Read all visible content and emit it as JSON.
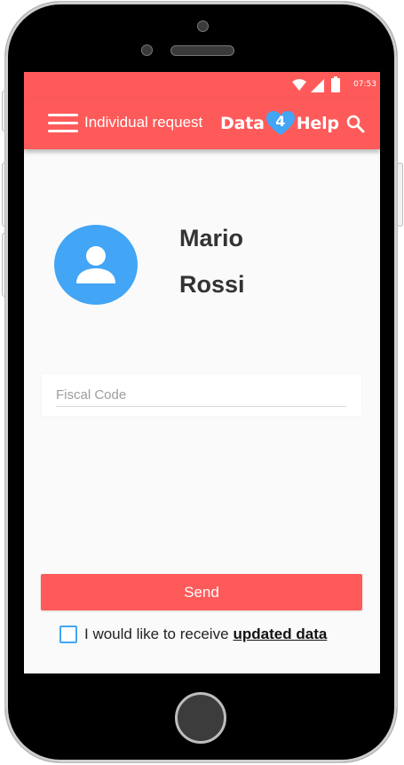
{
  "statusbar": {
    "time": "07:53"
  },
  "appbar": {
    "title": "Individual request",
    "logo": {
      "part1": "Data",
      "digit": "4",
      "part2": "Help"
    }
  },
  "profile": {
    "first_name": "Mario",
    "last_name": "Rossi"
  },
  "form": {
    "fiscal_code": {
      "placeholder": "Fiscal Code",
      "value": ""
    },
    "send_label": "Send",
    "consent": {
      "text": "I would like to receive",
      "link": "updated data",
      "checked": false
    }
  },
  "colors": {
    "primary": "#ff5a5a",
    "accent": "#42a5f5"
  }
}
